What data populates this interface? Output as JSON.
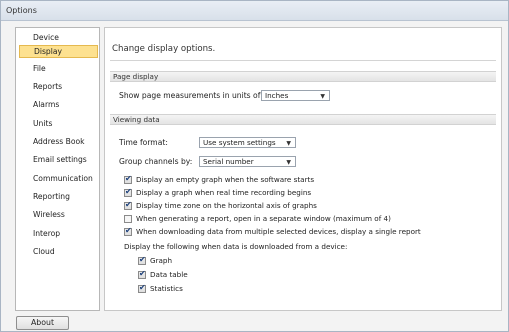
{
  "window": {
    "title": "Options"
  },
  "sidebar": {
    "items": [
      {
        "label": "Device",
        "active": false
      },
      {
        "label": "Display",
        "active": true
      },
      {
        "label": "File",
        "active": false
      },
      {
        "label": "Reports",
        "active": false
      },
      {
        "label": "Alarms",
        "active": false
      },
      {
        "label": "Units",
        "active": false
      },
      {
        "label": "Address Book",
        "active": false
      },
      {
        "label": "Email settings",
        "active": false
      },
      {
        "label": "Communication",
        "active": false
      },
      {
        "label": "Reporting",
        "active": false
      },
      {
        "label": "Wireless",
        "active": false
      },
      {
        "label": "Interop",
        "active": false
      },
      {
        "label": "Cloud",
        "active": false
      }
    ]
  },
  "main": {
    "title": "Change display options.",
    "page_display": {
      "header": "Page display",
      "units_label": "Show page measurements in units of:",
      "units_value": "Inches"
    },
    "viewing_data": {
      "header": "Viewing data",
      "time_format_label": "Time format:",
      "time_format_value": "Use system settings",
      "group_label": "Group channels by:",
      "group_value": "Serial number",
      "checkboxes": [
        {
          "label": "Display an empty graph when the software starts",
          "checked": true
        },
        {
          "label": "Display a graph when real time recording begins",
          "checked": true
        },
        {
          "label": "Display time zone on the horizontal axis of graphs",
          "checked": true
        },
        {
          "label": "When generating a report, open in a separate window (maximum of 4)",
          "checked": false
        },
        {
          "label": "When downloading data from multiple selected devices, display a single report",
          "checked": true
        }
      ],
      "download_label": "Display the following when data is downloaded from a device:",
      "download_options": [
        {
          "label": "Graph",
          "checked": true
        },
        {
          "label": "Data table",
          "checked": true
        },
        {
          "label": "Statistics",
          "checked": true
        }
      ]
    }
  },
  "footer": {
    "about_label": "About"
  },
  "colors": {
    "active_item": "#fde190",
    "active_border": "#e5b94f",
    "check_mark": "#1b3f7a"
  },
  "icons": {
    "dropdown": "chevron-down-icon",
    "check": "check-icon"
  }
}
